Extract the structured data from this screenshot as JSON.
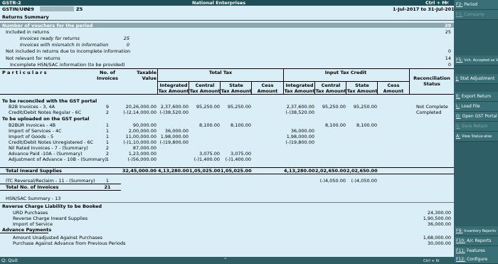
{
  "titlebar": {
    "left": "GSTR-2",
    "center": "National Enterprises",
    "right": "Ctrl + M"
  },
  "header": {
    "gstin_label": "GSTIN/UIN",
    "gstin_value": ": 29",
    "gstin_suffix": "Z5",
    "period": "1-Jul-2017 to 31-Jul-2017",
    "subtitle": "Returns Summary"
  },
  "summary": {
    "title": "Number of vouchers for the period",
    "total": "39",
    "included_label": "Included in returns",
    "included": "25",
    "ready_label": "Invoices ready for returns",
    "ready": "25",
    "mismatch_label": "Invoices with mismatch in information",
    "mismatch": "0",
    "not_included_label": "Not included in returns due to incomplete information",
    "not_included": "0",
    "not_relevant_label": "Not relevant for returns",
    "not_relevant": "14",
    "hsn_label": "Incomplete HSN/SAC information (to be provided)",
    "hsn": "0"
  },
  "columns": {
    "particulars": "P a r t i c u l a r s",
    "no_of": "No. of",
    "invoices": "Invoices",
    "taxable": "Taxable",
    "value": "Value",
    "total_tax": "Total Tax",
    "itc": "Input Tax Credit",
    "integrated": "Integrated",
    "central": "Central",
    "state": "State",
    "cess": "Cess",
    "tax_amount": "Tax Amount",
    "amount": "Amount",
    "recon": "Reconciliation",
    "status": "Status"
  },
  "sections": {
    "reconcile": "To be reconciled with the GST portal",
    "upload": "To be uploaded on the GST portal"
  },
  "rows": [
    {
      "label": "B2B Invoices - 3, 4A",
      "no": "9",
      "tv": "20,26,000.00",
      "ig": "2,37,600.00",
      "ce": "95,250.00",
      "st": "95,250.00",
      "cs": "",
      "iig": "2,37,600.00",
      "ice": "95,250.00",
      "ist": "95,250.00",
      "ics": "",
      "status": "Not Complete"
    },
    {
      "label": "Credit/Debit Notes Regular - 6C",
      "no": "2",
      "tv": "(-)2,14,000.00",
      "ig": "(-)38,520.00",
      "ce": "",
      "st": "",
      "cs": "",
      "iig": "(-)38,520.00",
      "ice": "",
      "ist": "",
      "ics": "",
      "status": "Completed"
    },
    {
      "label": "B2BUR Invoices - 4B",
      "no": "1",
      "tv": "90,000.00",
      "ig": "",
      "ce": "8,100.00",
      "st": "8,100.00",
      "cs": "",
      "iig": "",
      "ice": "8,100.00",
      "ist": "8,100.00",
      "ics": "",
      "status": ""
    },
    {
      "label": "Import of Services - 4C",
      "no": "1",
      "tv": "2,00,000.00",
      "ig": "36,000.00",
      "ce": "",
      "st": "",
      "cs": "",
      "iig": "36,000.00",
      "ice": "",
      "ist": "",
      "ics": "",
      "status": ""
    },
    {
      "label": "Import of Goods - 5",
      "no": "1",
      "tv": "11,00,000.00",
      "ig": "1,98,000.00",
      "ce": "",
      "st": "",
      "cs": "",
      "iig": "1,98,000.00",
      "ice": "",
      "ist": "",
      "ics": "",
      "status": ""
    },
    {
      "label": "Credit/Debit Notes Unregistered - 6C",
      "no": "1",
      "tv": "(-)1,10,000.00",
      "ig": "(-)19,800.00",
      "ce": "",
      "st": "",
      "cs": "",
      "iig": "(-)19,800.00",
      "ice": "",
      "ist": "",
      "ics": "",
      "status": ""
    },
    {
      "label": "Nil Rated Invoices - 7 - (Summary)",
      "no": "2",
      "tv": "87,000.00",
      "ig": "",
      "ce": "",
      "st": "",
      "cs": "",
      "iig": "",
      "ice": "",
      "ist": "",
      "ics": "",
      "status": ""
    },
    {
      "label": "Advance Paid -10A - (Summary)",
      "no": "2",
      "tv": "1,23,000.00",
      "ig": "",
      "ce": "3,075.00",
      "st": "3,075.00",
      "cs": "",
      "iig": "",
      "ice": "",
      "ist": "",
      "ics": "",
      "status": ""
    },
    {
      "label": "Adjustment of Advance - 10B - (Summary)",
      "no": "1",
      "tv": "(-)56,000.00",
      "ig": "",
      "ce": "(-)1,400.00",
      "st": "(-)1,400.00",
      "cs": "",
      "iig": "",
      "ice": "",
      "ist": "",
      "ics": "",
      "status": ""
    }
  ],
  "total_inward": {
    "label": "Total Inward Supplies",
    "tv": "32,45,000.00",
    "ig": "4,13,280.00",
    "ce": "1,05,025.00",
    "st": "1,05,025.00",
    "iig": "4,13,280.00",
    "ice": "2,02,650.00",
    "ist": "2,02,650.00"
  },
  "itc_rev": {
    "label": "ITC Reversal/Reclaim - 11 - (Summary)",
    "no": "1",
    "ice": "(-)4,050.00",
    "ist": "(-)4,050.00"
  },
  "total_invoices": {
    "label": "Total No. of Invoices",
    "no": "21"
  },
  "hsn_summary": "HSN/SAC Summary - 13",
  "reverse": {
    "title": "Reverse Charge Liability to be Booked",
    "urd_label": "URD Purchases",
    "urd": "24,300.00",
    "rc_label": "Reverse Charge Inward Supplies",
    "rc": "1,90,500.00",
    "ios_label": "Import of Service",
    "ios": "36,000.00"
  },
  "advance": {
    "title": "Advance Payments",
    "unadj_label": "Amount Unadjusted Against Purchases",
    "unadj": "1,68,000.00",
    "adv_label": "Purchase Against Advance from Previous Periods",
    "adv": "30,000.00"
  },
  "footer": {
    "quit": "Q: Quit",
    "hint": "Ctrl + N"
  },
  "right_buttons": [
    {
      "key": "F2:",
      "label": "Period",
      "disabled": false
    },
    {
      "key": "F3:",
      "label": "Company",
      "disabled": true
    },
    {
      "key": "F5:",
      "label": "Vch. Accepted as Valid",
      "disabled": false
    },
    {
      "key": "J:",
      "label": "Stat Adjustment",
      "disabled": false
    },
    {
      "key": "E:",
      "label": "Export Return",
      "disabled": false
    },
    {
      "key": "L:",
      "label": "Load File",
      "disabled": false
    },
    {
      "key": "O:",
      "label": "Open GST Portal",
      "disabled": false
    },
    {
      "key": "S:",
      "label": "Save Return",
      "disabled": true
    },
    {
      "key": "A:",
      "label": "View Status-wise",
      "disabled": false
    },
    {
      "key": "F9:",
      "label": "Inventory Reports",
      "disabled": false
    },
    {
      "key": "F10:",
      "label": "A/c Reports",
      "disabled": false
    },
    {
      "key": "F11:",
      "label": "Features",
      "disabled": false
    },
    {
      "key": "F12:",
      "label": "Configure",
      "disabled": false
    }
  ]
}
